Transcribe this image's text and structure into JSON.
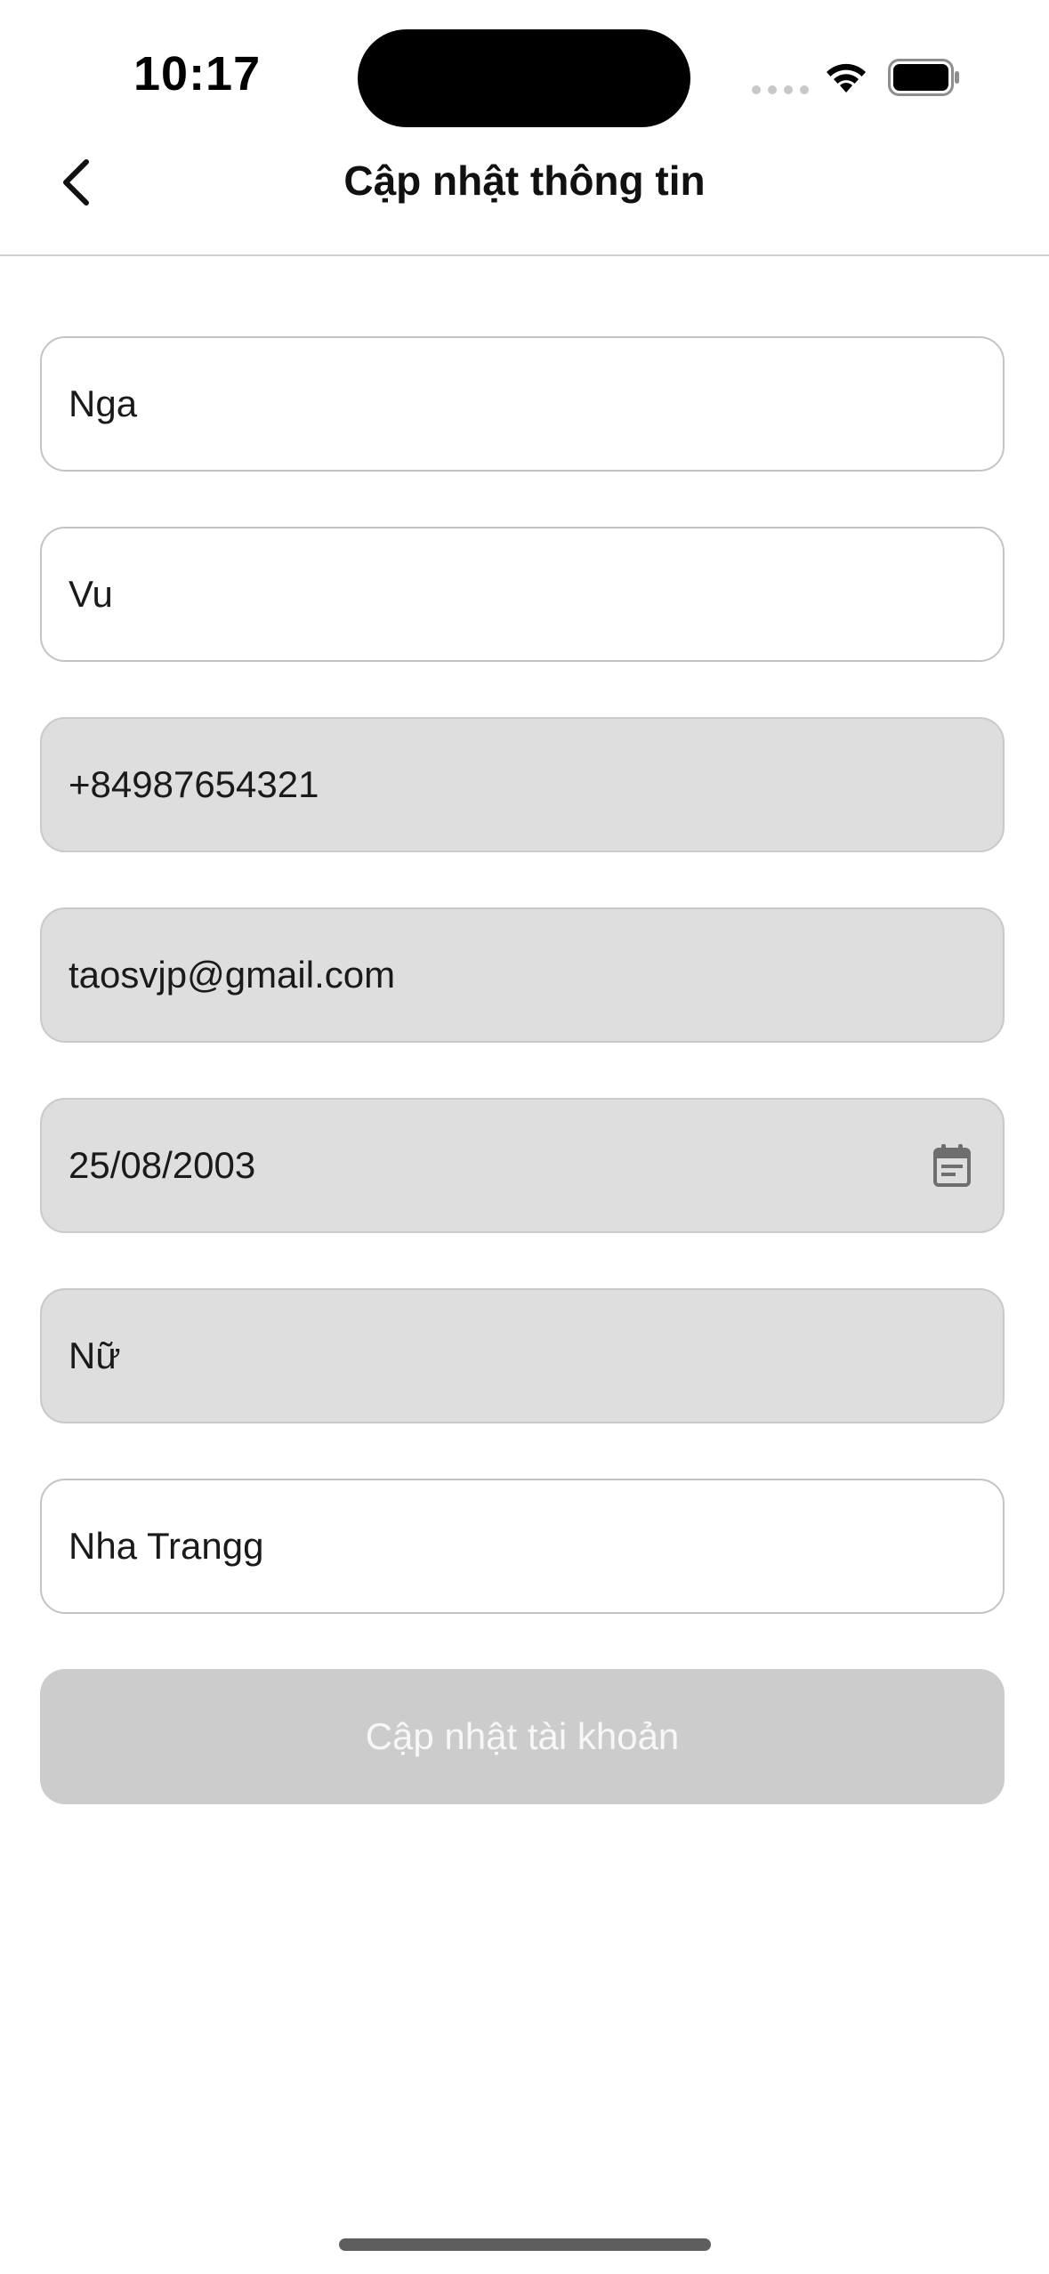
{
  "status_bar": {
    "time": "10:17"
  },
  "header": {
    "title": "Cập nhật thông tin",
    "back_icon": "chevron-left-icon"
  },
  "form": {
    "first_name": "Nga",
    "last_name": "Vu",
    "phone": "+84987654321",
    "email": "taosvjp@gmail.com",
    "birth_date": "25/08/2003",
    "gender": "Nữ",
    "address": "Nha Trangg",
    "submit_label": "Cập nhật tài khoản"
  },
  "colors": {
    "disabled_field_bg": "#dedede",
    "enabled_field_bg": "#ffffff",
    "field_border": "#c4c4c4",
    "submit_disabled_bg": "#cccccc"
  }
}
